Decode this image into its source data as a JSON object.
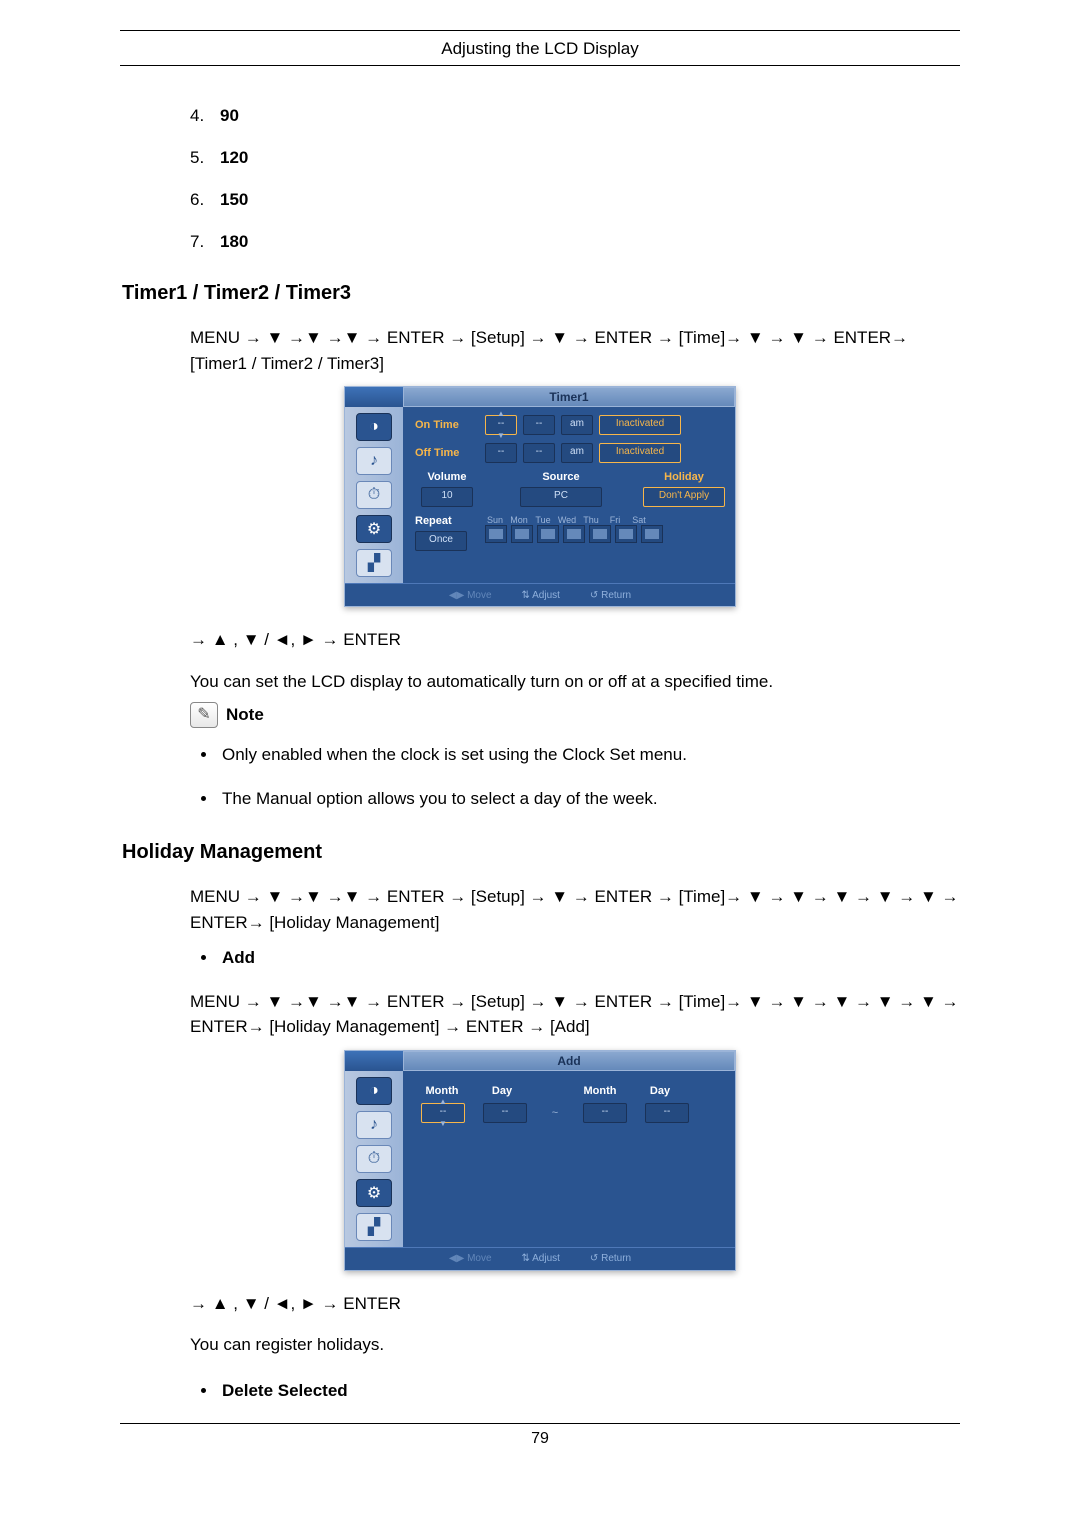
{
  "header": {
    "title": "Adjusting the LCD Display"
  },
  "list": {
    "items": [
      {
        "num": "4.",
        "val": "90"
      },
      {
        "num": "5.",
        "val": "120"
      },
      {
        "num": "6.",
        "val": "150"
      },
      {
        "num": "7.",
        "val": "180"
      }
    ]
  },
  "timer": {
    "heading": "Timer1 / Timer2 / Timer3",
    "nav": "MENU → ▼ →▼ →▼ → ENTER → [Setup] → ▼ → ENTER → [Time]→ ▼ → ▼ → ENTER→ [Timer1 / Timer2 / Timer3]",
    "post_nav": "→ ▲ , ▼ / ◄, ► → ENTER",
    "body": "You can set the LCD display to automatically turn on or off at a specified time.",
    "note_label": "Note",
    "notes": [
      "Only enabled when the clock is set using the Clock Set menu.",
      "The Manual option allows you to select a day of the week."
    ]
  },
  "osd_timer": {
    "title": "Timer1",
    "on_time": "On Time",
    "off_time": "Off Time",
    "volume": "Volume",
    "source": "Source",
    "holiday": "Holiday",
    "repeat": "Repeat",
    "val_dash": "--",
    "ampm": "am",
    "inactivated": "Inactivated",
    "vol_val": "10",
    "src_val": "PC",
    "hol_val": "Don't Apply",
    "repeat_val": "Once",
    "days": {
      "sun": "Sun",
      "mon": "Mon",
      "tue": "Tue",
      "wed": "Wed",
      "thu": "Thu",
      "fri": "Fri",
      "sat": "Sat"
    },
    "foot_move": "Move",
    "foot_adjust": "Adjust",
    "foot_return": "Return"
  },
  "holiday": {
    "heading": "Holiday Management",
    "nav": "MENU → ▼ →▼ →▼ → ENTER → [Setup] → ▼ → ENTER → [Time]→ ▼ → ▼ → ▼ → ▼ → ▼ → ENTER→ [Holiday Management]",
    "add_label": "Add",
    "nav_add": "MENU → ▼ →▼ →▼ → ENTER → [Setup] → ▼ → ENTER → [Time]→ ▼ → ▼ → ▼ → ▼ → ▼ → ENTER→ [Holiday Management] → ENTER → [Add]",
    "post_nav": "→ ▲ , ▼ / ◄, ► → ENTER",
    "body": "You can register holidays.",
    "delete_label": "Delete Selected"
  },
  "osd_add": {
    "title": "Add",
    "month": "Month",
    "day": "Day",
    "val_dash": "--",
    "foot_move": "Move",
    "foot_adjust": "Adjust",
    "foot_return": "Return"
  },
  "footer": {
    "page_number": "79"
  }
}
